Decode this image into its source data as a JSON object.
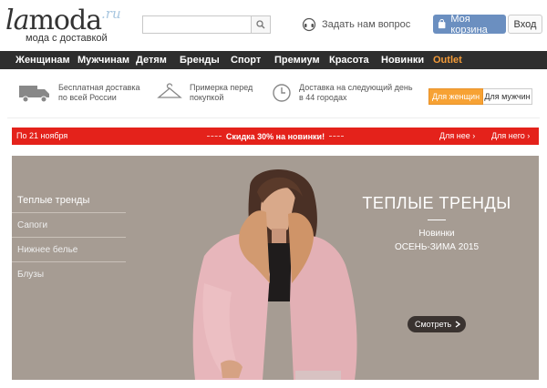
{
  "header": {
    "logo_main_1": "la",
    "logo_main_2": "moda",
    "logo_suffix": ".ru",
    "logo_tagline": "мода с доставкой",
    "search_placeholder": "",
    "ask_label": "Задать нам вопрос",
    "cart_label": "Моя корзина",
    "login_label": "Вход"
  },
  "nav": {
    "items": [
      "Женщинам",
      "Мужчинам",
      "Детям",
      "Бренды",
      "Спорт",
      "Премиум",
      "Красота",
      "Новинки",
      "Outlet"
    ]
  },
  "info": {
    "delivery_1": "Бесплатная доставка",
    "delivery_2": "по всей России",
    "fitting_1": "Примерка перед",
    "fitting_2": "покупкой",
    "nextday_1": "Доставка на следующий день",
    "nextday_2": "в 44 городах",
    "gender_women": "Для женщин",
    "gender_men": "Для мужчин"
  },
  "promo": {
    "left": "По 21 ноября",
    "center": "Скидка 30% на новинки!",
    "right_1": "Для нее ›",
    "right_2": "Для него ›"
  },
  "banner": {
    "side": [
      "Теплые тренды",
      "Сапоги",
      "Нижнее белье",
      "Блузы"
    ],
    "title": "ТЕПЛЫЕ ТРЕНДЫ",
    "sub_1": "Новинки",
    "sub_2": "ОСЕНЬ-ЗИМА 2015",
    "button": "Смотреть"
  },
  "colors": {
    "nav_bg": "#2e2e2e",
    "outlet": "#f29a38",
    "promo_red": "#e4221b",
    "cart_blue": "#6b8fc0",
    "gender_active": "#f7a234",
    "banner_bg": "#a69c93"
  },
  "icons": [
    "search-icon",
    "headset-icon",
    "cart-bag-icon",
    "truck-icon",
    "hanger-icon",
    "clock-icon",
    "chevron-right-icon"
  ]
}
